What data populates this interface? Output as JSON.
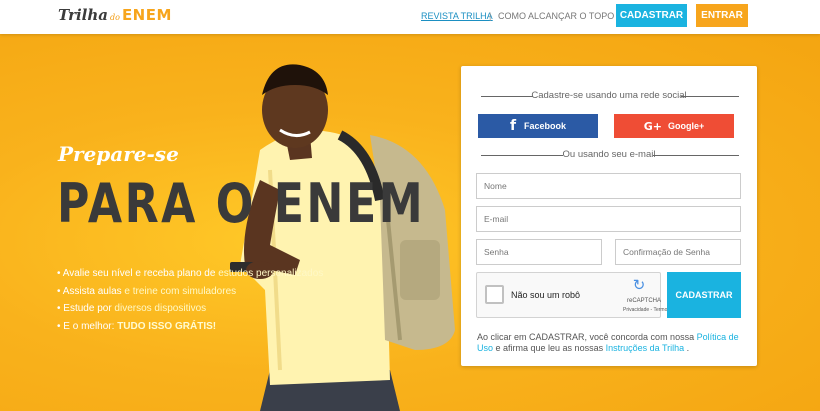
{
  "header": {
    "logo_script": "Trilha",
    "logo_do": "do",
    "logo_enem": "ENEM",
    "nav_revista": "REVISTA TRILHA",
    "nav_sep": "|",
    "nav_como": "COMO ALCANÇAR O TOPO",
    "btn_cadastrar": "CADASTRAR",
    "btn_entrar": "ENTRAR"
  },
  "hero": {
    "prepare": "Prepare-se",
    "headline": "PARA O ENEM",
    "bullets": [
      {
        "prefix": "• Avalie seu nível e receba plano de ",
        "highlight": "estudos personalizados",
        "suffix": ""
      },
      {
        "prefix": "• Assista aulas ",
        "highlight": "e treine com simuladores",
        "suffix": ""
      },
      {
        "prefix": "• Estude por ",
        "highlight": "diversos dispositivos",
        "suffix": ""
      },
      {
        "prefix": "• E o melhor: ",
        "highlight": "TUDO ISSO GRÁTIS!",
        "suffix": ""
      }
    ]
  },
  "form": {
    "social_title": "Cadastre-se usando uma rede social",
    "facebook_icon_glyph": "f",
    "facebook_label": "Facebook",
    "google_icon_glyph": "G+",
    "google_label": "Google+",
    "email_title": "Ou usando seu e-mail",
    "name_placeholder": "Nome",
    "email_placeholder": "E-mail",
    "password_placeholder": "Senha",
    "confirm_placeholder": "Confirmação de Senha",
    "captcha_label": "Não sou um robô",
    "recaptcha_brand": "reCAPTCHA",
    "recaptcha_links": "Privacidade - Termos",
    "submit_label": "CADASTRAR",
    "terms_part1": "Ao clicar em CADASTRAR, você concorda com nossa ",
    "terms_link1": "Política de Uso",
    "terms_part2": " e afirma que leu as nossas ",
    "terms_link2": "Instruções da Trilha",
    "terms_part3": " ."
  },
  "colors": {
    "brand_orange": "#f7a51c",
    "brand_blue": "#1ab3e0",
    "facebook": "#2b5aa5",
    "google": "#ef4d35"
  }
}
